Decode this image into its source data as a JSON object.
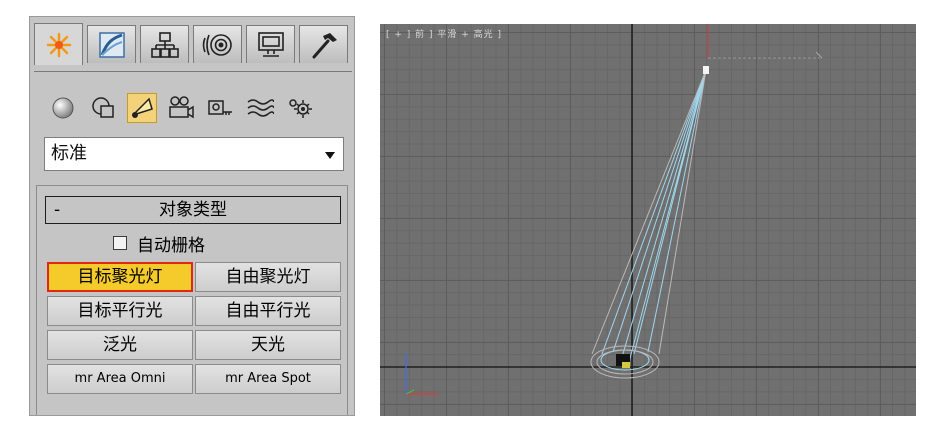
{
  "command_panel": {
    "tabs": [
      "create",
      "modify",
      "hierarchy",
      "motion",
      "display",
      "utilities"
    ],
    "active_tab": "create",
    "categories": [
      "geometry",
      "shapes",
      "lights",
      "cameras",
      "helpers",
      "space-warps",
      "systems"
    ],
    "active_category": "lights",
    "type_dropdown": {
      "selected": "标准"
    },
    "rollout": {
      "collapse_symbol": "-",
      "title": "对象类型",
      "autogrid_label": "自动栅格",
      "buttons": {
        "target_spot": "目标聚光灯",
        "free_spot": "自由聚光灯",
        "target_direct": "目标平行光",
        "free_direct": "自由平行光",
        "omni": "泛光",
        "skylight": "天光",
        "mr_area_omni": "mr Area Omni",
        "mr_area_spot": "mr Area Spot"
      },
      "selected_button": "目标聚光灯"
    }
  },
  "viewport": {
    "label": "[ + ] 前 ] 平滑 + 高光 ]",
    "background": "#707070",
    "cone_color": "#9fd7ee",
    "axis_colors": {
      "x": "#e03a3a",
      "y": "#3fbf3f",
      "z": "#3a6ef0"
    }
  }
}
